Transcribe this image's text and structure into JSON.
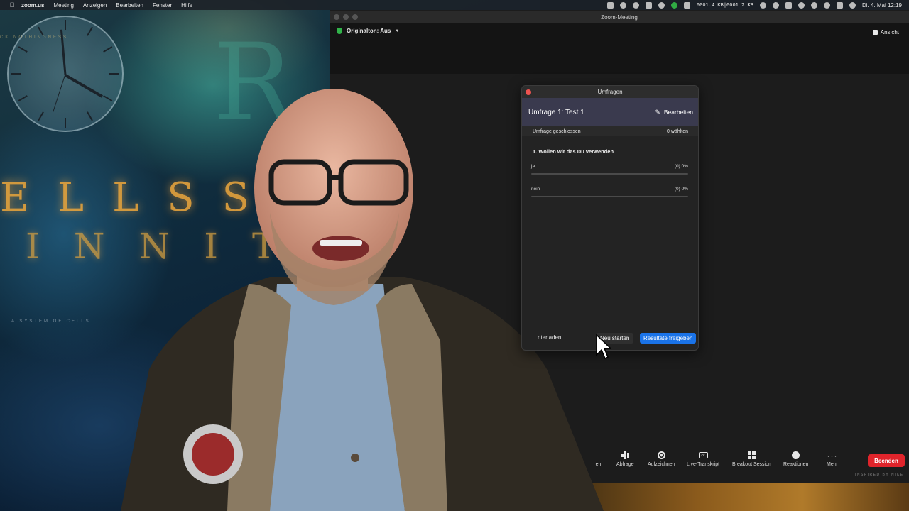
{
  "menubar": {
    "app": "zoom.us",
    "menus": [
      "Meeting",
      "Anzeigen",
      "Bearbeiten",
      "Fenster",
      "Hilfe"
    ],
    "network": "0001.4 KB|0001.2 KB",
    "datetime": "Di. 4. Mai 12:19"
  },
  "zoom_window": {
    "title": "Zoom-Meeting",
    "original_sound": "Originalton: Aus",
    "view_label": "Ansicht"
  },
  "poll": {
    "window_title": "Umfragen",
    "poll_name": "Umfrage 1: Test 1",
    "edit_label": "Bearbeiten",
    "status": "Umfrage geschlossen",
    "votes": "0 wählten",
    "question": "1. Wollen wir das Du verwenden",
    "answers": [
      {
        "label": "ja",
        "result": "(0) 0%",
        "percent": 0
      },
      {
        "label": "nein",
        "result": "(0) 0%",
        "percent": 0
      }
    ],
    "download_label": "nterladen",
    "restart_label": "Neu starten",
    "share_label": "Resultate freigeben"
  },
  "controls": {
    "partial_label": "en",
    "items": [
      "Abfrage",
      "Aufzeichnen",
      "Live-Transkript",
      "Breakout Session",
      "Reaktionen",
      "Mehr"
    ],
    "end_label": "Beenden"
  },
  "poster": {
    "top_text": "CK NOTHINGNESS",
    "line1": "ELLSS",
    "line2": "INNIT",
    "subtitle": "A SYSTEM OF CELLS",
    "corner": "INSPIRED BY NIKE"
  },
  "colors": {
    "zoom_blue": "#1a73e8",
    "end_red": "#e0242b",
    "secure_green": "#31b34a"
  }
}
